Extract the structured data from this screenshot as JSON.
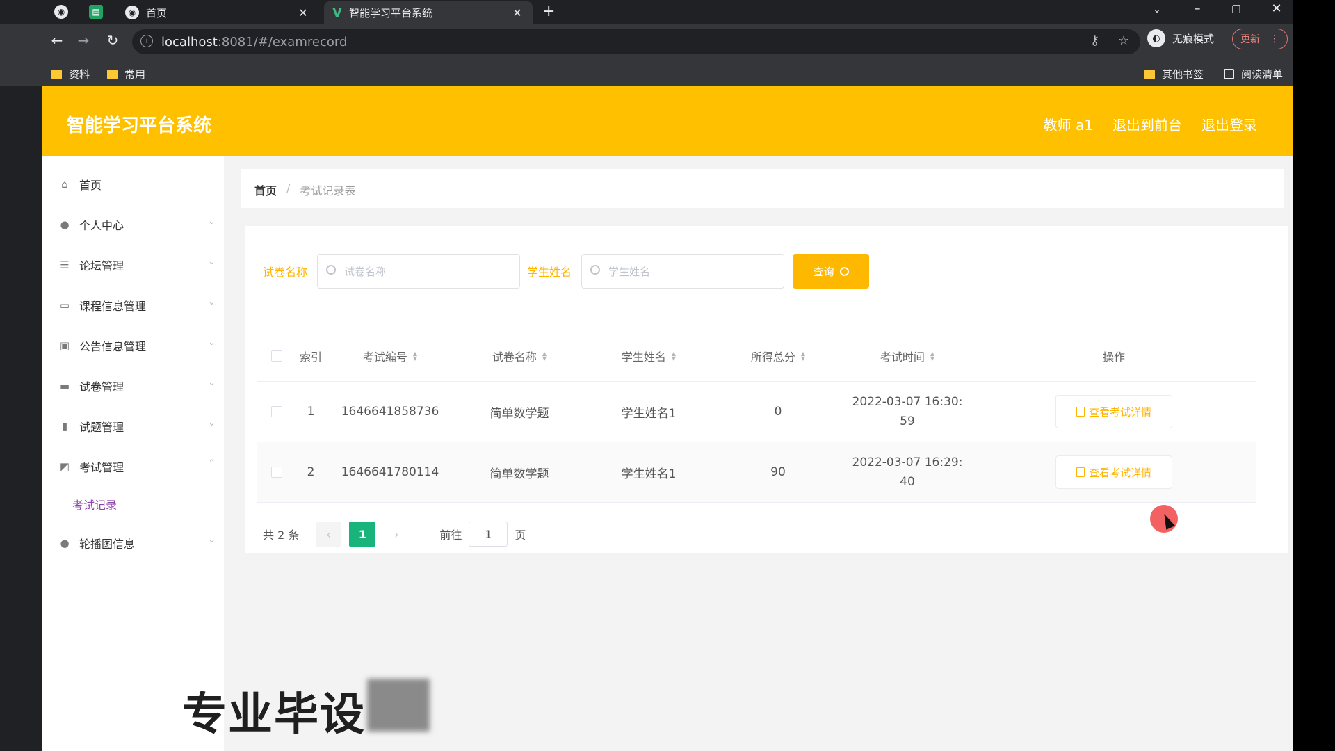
{
  "browser": {
    "tabs": [
      {
        "title": "首页",
        "active": false
      },
      {
        "title": "智能学习平台系统",
        "active": true
      }
    ],
    "url_host": "localhost",
    "url_path": ":8081/#/examrecord",
    "incognito_label": "无痕模式",
    "update_label": "更新",
    "bookmarks": [
      "资料",
      "常用"
    ],
    "bookmarks_right": [
      "其他书签",
      "阅读清单"
    ]
  },
  "app": {
    "title": "智能学习平台系统",
    "header_links": [
      "教师 a1",
      "退出到前台",
      "退出登录"
    ]
  },
  "sidebar": {
    "items": [
      {
        "label": "首页",
        "icon": "home-icon"
      },
      {
        "label": "个人中心",
        "icon": "user-icon"
      },
      {
        "label": "论坛管理",
        "icon": "sliders-icon"
      },
      {
        "label": "课程信息管理",
        "icon": "card-icon"
      },
      {
        "label": "公告信息管理",
        "icon": "clipboard-icon"
      },
      {
        "label": "试卷管理",
        "icon": "monitor-icon"
      },
      {
        "label": "试题管理",
        "icon": "bar-chart-icon"
      },
      {
        "label": "考试管理",
        "icon": "chart-icon"
      },
      {
        "label": "轮播图信息",
        "icon": "user-icon"
      }
    ],
    "sub_item": "考试记录"
  },
  "breadcrumb": {
    "home": "首页",
    "current": "考试记录表"
  },
  "search": {
    "paper_label": "试卷名称",
    "paper_placeholder": "试卷名称",
    "student_label": "学生姓名",
    "student_placeholder": "学生姓名",
    "query_button": "查询"
  },
  "table": {
    "headers": [
      "索引",
      "考试编号",
      "试卷名称",
      "学生姓名",
      "所得总分",
      "考试时间",
      "操作"
    ],
    "rows": [
      {
        "index": "1",
        "id": "1646641858736",
        "paper": "简单数学题",
        "student": "学生姓名1",
        "score": "0",
        "time": "2022-03-07 16:30:\n59",
        "action": "查看考试详情"
      },
      {
        "index": "2",
        "id": "1646641780114",
        "paper": "简单数学题",
        "student": "学生姓名1",
        "score": "90",
        "time": "2022-03-07 16:29:\n40",
        "action": "查看考试详情"
      }
    ]
  },
  "pagination": {
    "total": "共 2 条",
    "current_page": "1",
    "goto_prefix": "前往",
    "goto_value": "1",
    "goto_suffix": "页"
  },
  "overlay": {
    "watermark": "专业毕设"
  },
  "colors": {
    "header_bg": "#ffc000",
    "accent": "#ffb400",
    "pager_active": "#19b37c",
    "submenu": "#8e44ad"
  }
}
